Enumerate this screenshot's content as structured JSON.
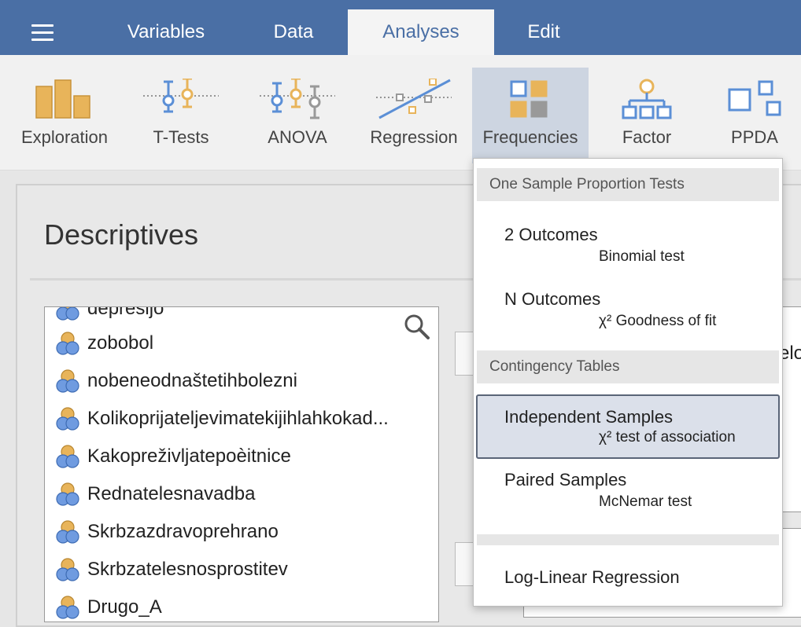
{
  "menubar": {
    "tabs": [
      "Variables",
      "Data",
      "Analyses",
      "Edit"
    ],
    "active_tab": "Analyses"
  },
  "ribbon": {
    "buttons": [
      "Exploration",
      "T-Tests",
      "ANOVA",
      "Regression",
      "Frequencies",
      "Factor",
      "PPDA"
    ],
    "active": "Frequencies"
  },
  "analysis": {
    "title": "Descriptives"
  },
  "variables": [
    "depresijo",
    "zobobol",
    "nobeneodnaštetihbolezni",
    "Kolikoprijateljevimatekijihlahkokad...",
    "Kakopreživljatepoèitnice",
    "Rednatelesnavadba",
    "Skrbzazdravoprehrano",
    "Skrbzatelesnosprostitev",
    "Drugo_A"
  ],
  "right_panel": {
    "cutoff_text": "elo"
  },
  "dropdown": {
    "sections": [
      {
        "header": "One Sample Proportion Tests",
        "items": [
          {
            "title": "2 Outcomes",
            "subtitle": "Binomial test"
          },
          {
            "title": "N Outcomes",
            "subtitle": "χ² Goodness of fit"
          }
        ]
      },
      {
        "header": "Contingency Tables",
        "items": [
          {
            "title": "Independent Samples",
            "subtitle": "χ² test of association"
          },
          {
            "title": "Paired Samples",
            "subtitle": "McNemar test"
          }
        ]
      },
      {
        "header": "",
        "items": [
          {
            "title": "Log-Linear Regression",
            "subtitle": ""
          }
        ]
      }
    ],
    "selected": "Independent Samples"
  },
  "colors": {
    "menubar": "#4a6fa5",
    "ribbon_icon_orange": "#e8b45a",
    "ribbon_icon_blue": "#5b8fd6",
    "selected_item": "#dbe0ea"
  },
  "icons": {
    "menu": "hamburger-icon",
    "search": "search-icon",
    "variable": "nominal-variable-icon"
  }
}
